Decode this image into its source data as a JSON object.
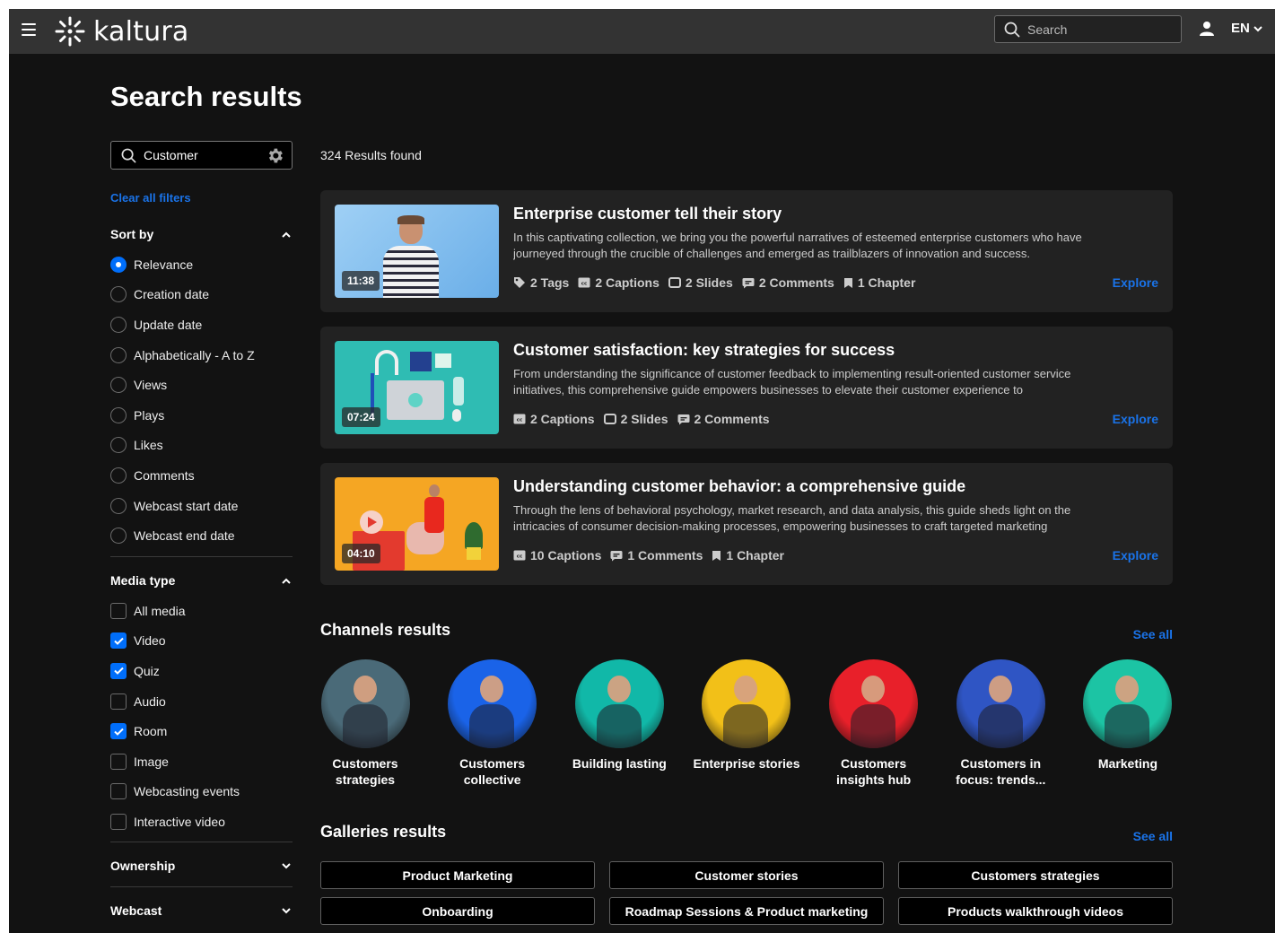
{
  "header": {
    "brand": "kaltura",
    "search_placeholder": "Search",
    "language": "EN"
  },
  "page": {
    "title": "Search results"
  },
  "sidebar": {
    "search_value": "Customer",
    "clear_filters": "Clear all filters",
    "sort_by": {
      "label": "Sort by",
      "expanded": true,
      "selected": "Relevance",
      "options": [
        "Relevance",
        "Creation date",
        "Update date",
        "Alphabetically - A to Z",
        "Views",
        "Plays",
        "Likes",
        "Comments",
        "Webcast start date",
        "Webcast end date"
      ]
    },
    "media_type": {
      "label": "Media type",
      "expanded": true,
      "options": [
        {
          "label": "All media",
          "checked": false
        },
        {
          "label": "Video",
          "checked": true
        },
        {
          "label": "Quiz",
          "checked": true
        },
        {
          "label": "Audio",
          "checked": false
        },
        {
          "label": "Room",
          "checked": true
        },
        {
          "label": "Image",
          "checked": false
        },
        {
          "label": "Webcasting events",
          "checked": false
        },
        {
          "label": "Interactive video",
          "checked": false
        }
      ]
    },
    "ownership": {
      "label": "Ownership",
      "expanded": false
    },
    "webcast": {
      "label": "Webcast",
      "expanded": false
    }
  },
  "results": {
    "count_text": "324 Results found",
    "entries": [
      {
        "title": "Enterprise customer tell their story",
        "description": "In this captivating collection, we bring you the powerful narratives of esteemed enterprise customers who have journeyed through the crucible of challenges and emerged as trailblazers of innovation and success.",
        "duration": "11:38",
        "meta": [
          {
            "icon": "tag-icon",
            "text": "2 Tags"
          },
          {
            "icon": "captions-icon",
            "text": "2 Captions"
          },
          {
            "icon": "slides-icon",
            "text": "2 Slides"
          },
          {
            "icon": "comments-icon",
            "text": "2 Comments"
          },
          {
            "icon": "chapter-icon",
            "text": "1 Chapter"
          }
        ],
        "action": "Explore"
      },
      {
        "title": "Customer satisfaction: key strategies for success",
        "description": "From understanding the significance of customer feedback to implementing result-oriented customer service initiatives, this comprehensive guide empowers businesses to elevate their customer experience to",
        "duration": "07:24",
        "meta": [
          {
            "icon": "captions-icon",
            "text": "2 Captions"
          },
          {
            "icon": "slides-icon",
            "text": "2 Slides"
          },
          {
            "icon": "comments-icon",
            "text": "2 Comments"
          }
        ],
        "action": "Explore"
      },
      {
        "title": "Understanding customer behavior: a comprehensive guide",
        "description": "Through the lens of behavioral psychology, market research, and data analysis, this guide sheds light on the intricacies of consumer decision-making processes, empowering businesses to craft targeted marketing",
        "duration": "04:10",
        "meta": [
          {
            "icon": "captions-icon",
            "text": "10 Captions"
          },
          {
            "icon": "comments-icon",
            "text": "1 Comments"
          },
          {
            "icon": "chapter-icon",
            "text": "1 Chapter"
          }
        ],
        "action": "Explore"
      }
    ]
  },
  "channels": {
    "title": "Channels results",
    "see_all": "See all",
    "items": [
      {
        "name": "Customers strategies",
        "color": "#4a6a78"
      },
      {
        "name": "Customers collective",
        "color": "#1a63e8"
      },
      {
        "name": "Building lasting",
        "color": "#11b8a8"
      },
      {
        "name": "Enterprise stories",
        "color": "#f2c018"
      },
      {
        "name": "Customers insights hub",
        "color": "#e8202a"
      },
      {
        "name": "Customers in focus: trends...",
        "color": "#2f55c4"
      },
      {
        "name": "Marketing",
        "color": "#1cc4a4"
      }
    ]
  },
  "galleries": {
    "title": "Galleries results",
    "see_all": "See all",
    "items": [
      "Product Marketing",
      "Customer stories",
      "Customers strategies",
      "Onboarding",
      "Roadmap Sessions & Product marketing",
      "Products walkthrough videos"
    ]
  },
  "colors": {
    "accent": "#006efa",
    "link": "#1a73e8",
    "background": "#121212",
    "header": "#333333",
    "card": "#222222"
  }
}
